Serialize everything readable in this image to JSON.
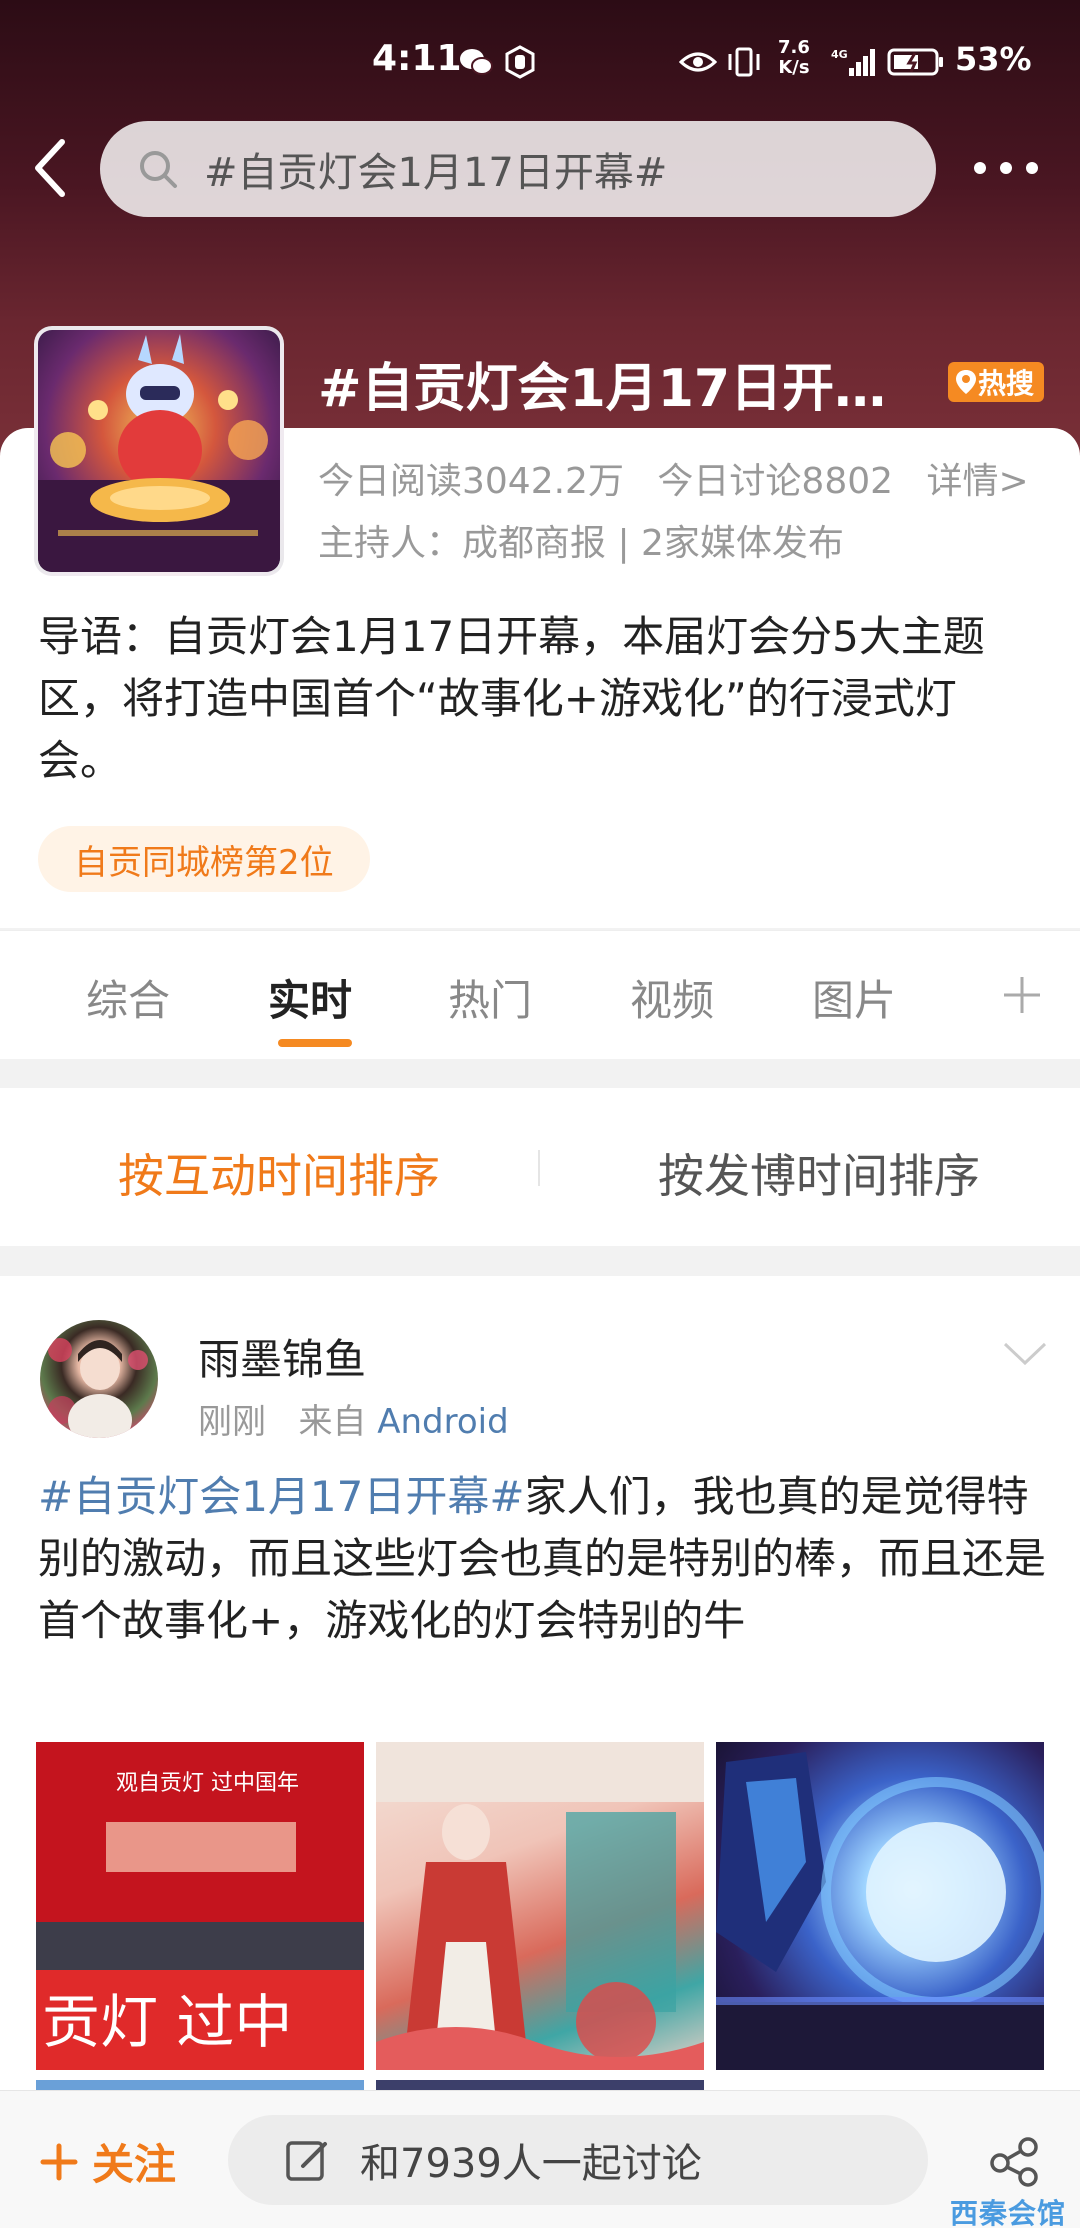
{
  "status_bar": {
    "time": "4:11",
    "speed_value": "7.6",
    "speed_unit": "K/s",
    "battery": "53%"
  },
  "search": {
    "query": "#自贡灯会1月17日开幕#"
  },
  "topic": {
    "title": "#自贡灯会1月17日开…",
    "hot_badge": "热搜",
    "stats_reads": "今日阅读3042.2万",
    "stats_discuss": "今日讨论8802",
    "stats_detail": "详情>",
    "host": "主持人：成都商报 | 2家媒体发布",
    "intro": "导语：自贡灯会1月17日开幕，本届灯会分5大主题区，将打造中国首个“故事化+游戏化”的行浸式灯会。",
    "rank": "自贡同城榜第2位"
  },
  "tabs": [
    {
      "label": "综合"
    },
    {
      "label": "实时"
    },
    {
      "label": "热门"
    },
    {
      "label": "视频"
    },
    {
      "label": "图片"
    }
  ],
  "sort": {
    "by_interaction": "按互动时间排序",
    "by_post_time": "按发博时间排序"
  },
  "post": {
    "author": "雨墨锦鱼",
    "time": "刚刚",
    "source_prefix": "来自",
    "source": "Android",
    "hashtag": "#自贡灯会1月17日开幕#",
    "body": "家人们，我也真的是觉得特别的激动，而且这些灯会也真的是特别的棒，而且还是首个故事化+，游戏化的灯会特别的牛",
    "images": [
      {
        "alt": "观自贡灯 过中国年 舞台"
      },
      {
        "alt": "汉服人物与灯组"
      },
      {
        "alt": "科幻灯组夜景"
      }
    ],
    "img1_banner": "观自贡灯 过中国年",
    "img1_big": "贡灯  过中"
  },
  "bottom_bar": {
    "follow": "关注",
    "discuss_placeholder": "和7939人一起讨论"
  },
  "watermark": "西秦会馆",
  "colors": {
    "accent": "#f58a22",
    "link": "#507daf",
    "hero_dark": "#2c0c15"
  }
}
